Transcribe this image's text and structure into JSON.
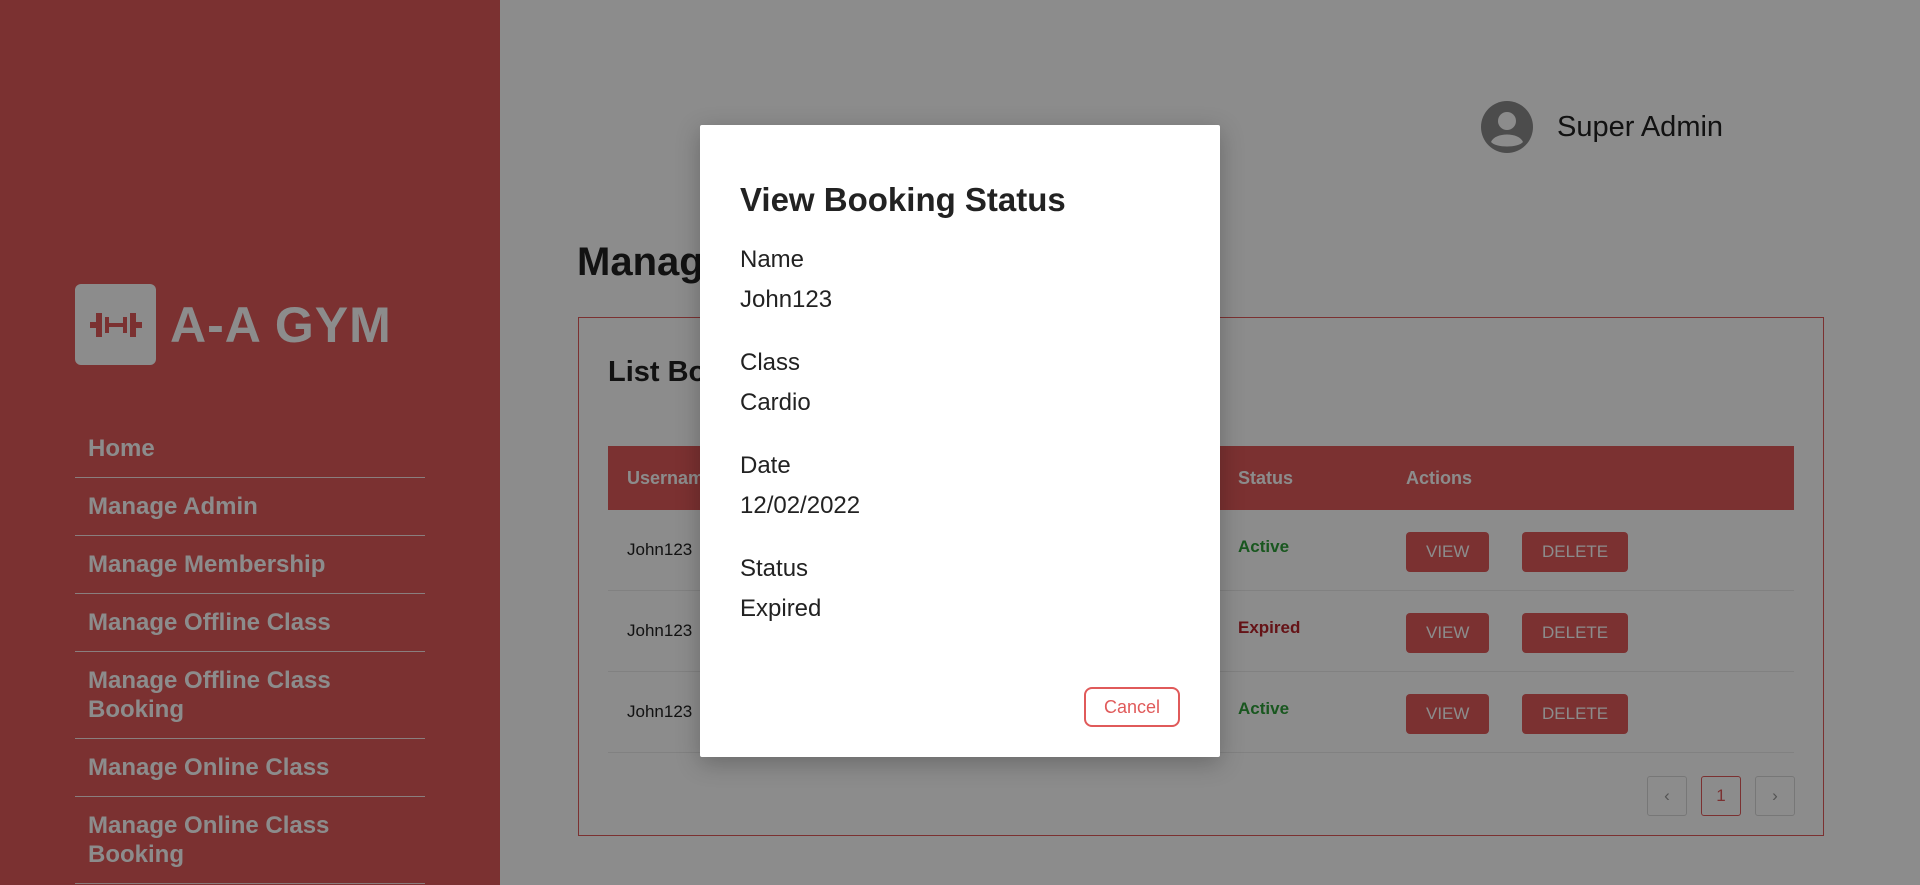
{
  "brand": {
    "name": "A-A GYM",
    "logo_icon": "dumbbell-icon"
  },
  "sidebar": {
    "items": [
      {
        "label": "Home"
      },
      {
        "label": "Manage Admin"
      },
      {
        "label": "Manage Membership"
      },
      {
        "label": "Manage Offline Class"
      },
      {
        "label": "Manage Offline Class Booking"
      },
      {
        "label": "Manage Online Class"
      },
      {
        "label": "Manage Online Class Booking"
      }
    ]
  },
  "header": {
    "user_name": "Super Admin",
    "avatar_icon": "user-avatar-icon"
  },
  "main": {
    "page_title": "Manag",
    "panel_title": "List Bo",
    "table": {
      "columns": [
        "Usernam",
        "Status",
        "Actions"
      ],
      "rows": [
        {
          "username": "John123",
          "status": "Active",
          "status_kind": "active"
        },
        {
          "username": "John123",
          "status": "Expired",
          "status_kind": "expired"
        },
        {
          "username": "John123",
          "status": "Active",
          "status_kind": "active"
        }
      ],
      "view_label": "VIEW",
      "delete_label": "DELETE"
    },
    "pagination": {
      "prev": "‹",
      "current": "1",
      "next": "›"
    }
  },
  "modal": {
    "title": "View Booking Status",
    "fields": [
      {
        "label": "Name",
        "value": "John123"
      },
      {
        "label": "Class",
        "value": "Cardio"
      },
      {
        "label": "Date",
        "value": "12/02/2022"
      },
      {
        "label": "Status",
        "value": "Expired"
      }
    ],
    "cancel_label": "Cancel"
  },
  "colors": {
    "accent": "#e05a5a",
    "active": "#2e9e3a",
    "expired": "#b8242b"
  }
}
